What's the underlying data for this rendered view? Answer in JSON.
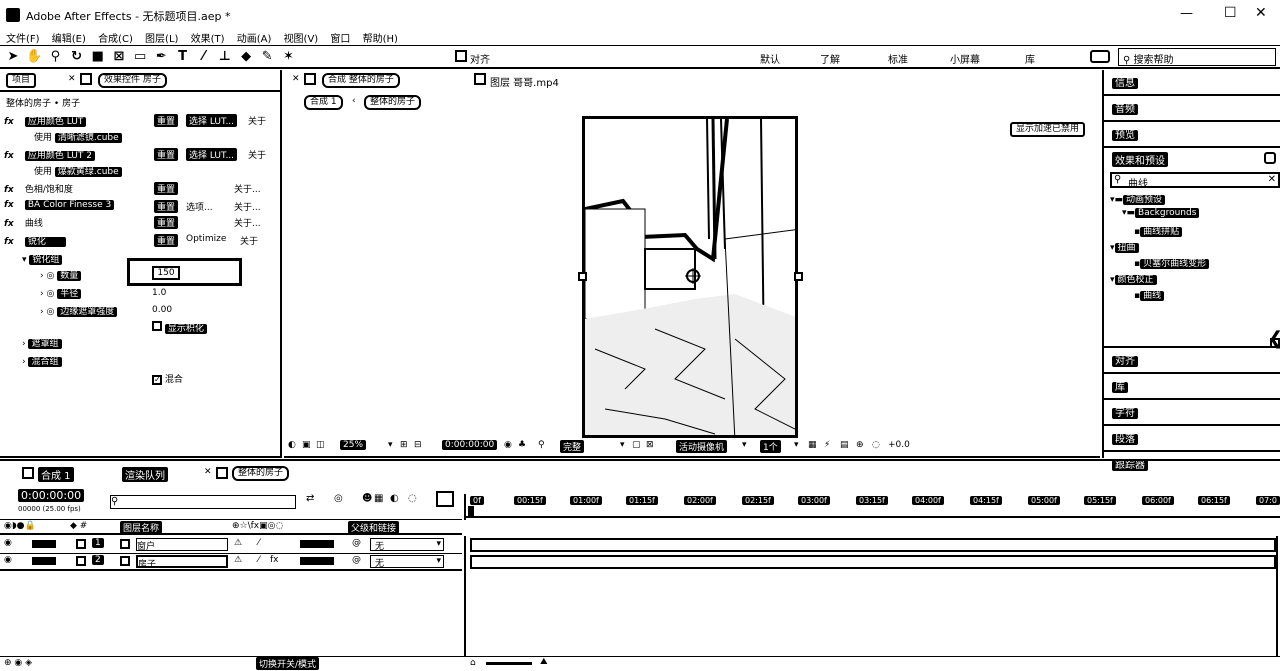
{
  "window": {
    "title": "Adobe After Effects - 无标题项目.aep *",
    "controls": {
      "minimize": "—",
      "maximize": "☐",
      "close": "✕"
    }
  },
  "menu": [
    "文件(F)",
    "编辑(E)",
    "合成(C)",
    "图层(L)",
    "效果(T)",
    "动画(A)",
    "视图(V)",
    "窗口",
    "帮助(H)"
  ],
  "toolbar": {
    "tools": [
      "arrow-tool",
      "hand-tool",
      "zoom-tool",
      "rotate-tool",
      "camera-tool",
      "pan-behind-tool",
      "rect-mask-tool",
      "pen-tool",
      "type-tool",
      "brush-tool",
      "clone-tool",
      "eraser-tool",
      "roto-tool",
      "puppet-tool"
    ],
    "align_label": "对齐",
    "workspaces": [
      "默认",
      "了解",
      "标准",
      "小屏幕",
      "库"
    ],
    "search_help": "搜索帮助"
  },
  "project_panel": {
    "tab_project": "项目",
    "tab_effect_controls": "效果控件 房子",
    "breadcrumb_comp": "整体的房子",
    "breadcrumb_layer": "房子",
    "effects": [
      {
        "name": "应用颜色 LUT",
        "reset": "重置",
        "extra": "选择 LUT...",
        "about": "关于",
        "sub_label": "使用",
        "sub_value": "清晰滤镜.cube"
      },
      {
        "name": "应用颜色 LUT 2",
        "reset": "重置",
        "extra": "选择 LUT...",
        "about": "关于",
        "sub_label": "使用",
        "sub_value": "爆款黄绿.cube"
      },
      {
        "name": "色相/饱和度",
        "reset": "重置",
        "extra": "",
        "about": "关于..."
      },
      {
        "name": "BA Color Finesse 3",
        "reset": "重置",
        "extra": "选项...",
        "about": "关于..."
      },
      {
        "name": "曲线",
        "reset": "重置",
        "extra": "",
        "about": "关于..."
      },
      {
        "name": "锐化",
        "reset": "重置",
        "extra": "Optimize",
        "about": "关于"
      }
    ],
    "sharpen_group": "锐化组",
    "props": [
      {
        "name": "数量",
        "value": "150"
      },
      {
        "name": "半径",
        "value": "1.0"
      },
      {
        "name": "边缘遮罩强度",
        "value": "0.00"
      }
    ],
    "show_mask": "显示积化",
    "group2": "遮罩组",
    "group3": "混合组",
    "group3_check": "混合"
  },
  "composition": {
    "tab_comp": "合成 整体的房子",
    "tab_layer": "图层 哥哥.mp4",
    "crumb1": "合成 1",
    "crumb2": "整体的房子",
    "accel_notice": "显示加速已禁用",
    "zoom": "25%",
    "timecode": "0:00:00:00",
    "quality": "完整",
    "camera": "活动摄像机",
    "views": "1个",
    "offset": "+0.0"
  },
  "right_panel": {
    "items": [
      "信息",
      "音频",
      "预览",
      "效果和预设"
    ],
    "search_value": "曲线",
    "tree": [
      {
        "label": "动画预设",
        "indent": 0
      },
      {
        "label": "Backgrounds",
        "indent": 1
      },
      {
        "label": "曲线拼贴",
        "indent": 2
      },
      {
        "label": "扭曲",
        "indent": 0
      },
      {
        "label": "贝塞尔曲线变形",
        "indent": 1
      },
      {
        "label": "颜色校正",
        "indent": 0
      },
      {
        "label": "曲线",
        "indent": 1
      }
    ],
    "bottom_items": [
      "对齐",
      "库",
      "字符",
      "段落",
      "跟踪器"
    ]
  },
  "timeline": {
    "tabs": [
      "合成 1",
      "渲染队列",
      "整体的房子"
    ],
    "timecode": "0:00:00:00",
    "frame_info": "00000 (25.00 fps)",
    "columns": {
      "source_name": "图层名称",
      "parent": "父级和链接"
    },
    "layers": [
      {
        "num": "1",
        "name": "窗户",
        "parent": "无"
      },
      {
        "num": "2",
        "name": "房子",
        "parent": "无"
      }
    ],
    "ruler": [
      "0f",
      "00:15f",
      "01:00f",
      "01:15f",
      "02:00f",
      "02:15f",
      "03:00f",
      "03:15f",
      "04:00f",
      "04:15f",
      "05:00f",
      "05:15f",
      "06:00f",
      "06:15f",
      "07:0"
    ],
    "footer_mode": "切换开关/模式"
  }
}
